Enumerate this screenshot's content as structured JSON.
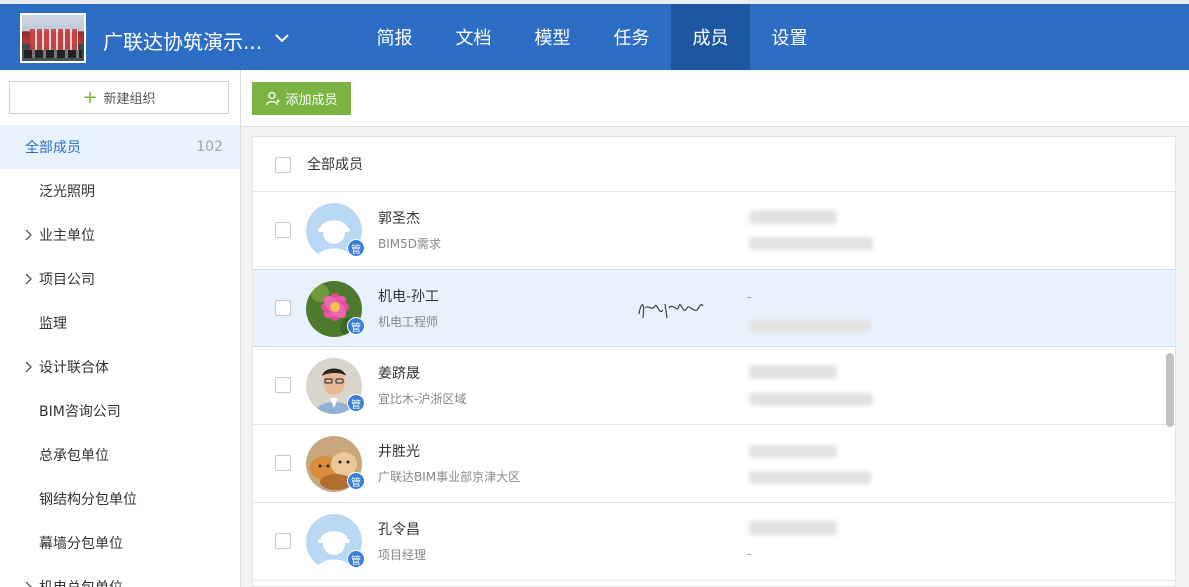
{
  "header": {
    "project_title": "广联达协筑演示...",
    "tabs": [
      {
        "label": "简报",
        "active": false
      },
      {
        "label": "文档",
        "active": false
      },
      {
        "label": "模型",
        "active": false
      },
      {
        "label": "任务",
        "active": false
      },
      {
        "label": "成员",
        "active": true
      },
      {
        "label": "设置",
        "active": false
      }
    ],
    "colors": {
      "bar": "#2d6ec4",
      "active_tab": "#1d56a0"
    }
  },
  "sidebar": {
    "new_org_label": "新建组织",
    "all_members": {
      "label": "全部成员",
      "count": "102"
    },
    "items": [
      {
        "label": "泛光照明",
        "expandable": false
      },
      {
        "label": "业主单位",
        "expandable": true
      },
      {
        "label": "项目公司",
        "expandable": true
      },
      {
        "label": "监理",
        "expandable": false
      },
      {
        "label": "设计联合体",
        "expandable": true
      },
      {
        "label": "BIM咨询公司",
        "expandable": false
      },
      {
        "label": "总承包单位",
        "expandable": false
      },
      {
        "label": "钢结构分包单位",
        "expandable": false
      },
      {
        "label": "幕墙分包单位",
        "expandable": false
      },
      {
        "label": "机电总包单位",
        "expandable": true
      }
    ]
  },
  "toolbar": {
    "add_member_label": "添加成员",
    "button_color": "#7cb342"
  },
  "member_list": {
    "header_label": "全部成员",
    "admin_badge": "管",
    "members": [
      {
        "name": "郭圣杰",
        "role": "BIM5D需求",
        "avatar": "helmet-avatar-icon",
        "selected": false
      },
      {
        "name": "机电-孙工",
        "role": "机电工程师",
        "avatar": "flower-photo-avatar",
        "selected": true,
        "contact_dash": "-"
      },
      {
        "name": "姜跻晟",
        "role": "宜比木-沪浙区域",
        "avatar": "person-photo-avatar",
        "selected": false
      },
      {
        "name": "井胜光",
        "role": "广联达BIM事业部京津大区",
        "avatar": "cats-photo-avatar",
        "selected": false
      },
      {
        "name": "孔令昌",
        "role": "项目经理",
        "avatar": "helmet-avatar-icon",
        "selected": false,
        "contact_dash": "-"
      }
    ]
  }
}
